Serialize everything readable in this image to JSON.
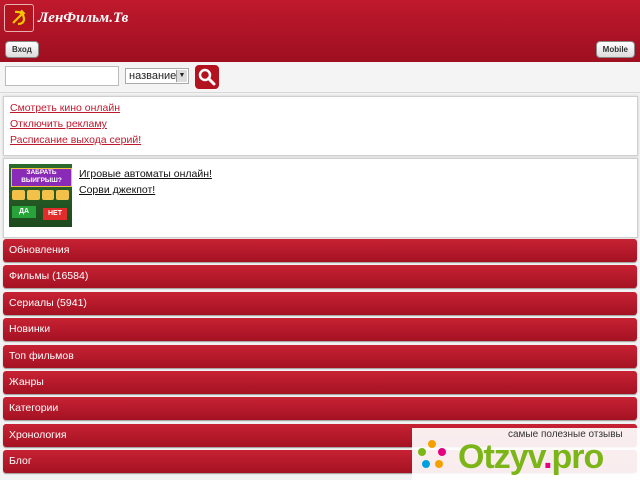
{
  "header": {
    "site_title": "ЛенФильм.Тв",
    "logo_icon": "hammer-sickle-icon",
    "login_label": "Вход",
    "mobile_label": "Mobile"
  },
  "search": {
    "input_value": "",
    "select_value": "название",
    "button_icon": "search-icon"
  },
  "links": [
    "Смотреть кино онлайн",
    "Отключить рекламу",
    "Расписание выхода серий!"
  ],
  "ad": {
    "banner_text": "ЗАБРАТЬ ВЫИГРЫШ?",
    "yes_label": "ДА",
    "no_label": "НЕТ",
    "line1": "Игровые автоматы онлайн!",
    "line2": "Сорви джекпот!"
  },
  "menu": [
    "Обновления",
    "Фильмы (16584)",
    "Сериалы (5941)",
    "Новинки",
    "Топ фильмов",
    "Жанры",
    "Категории",
    "Хронология",
    "Блог"
  ],
  "watermark": {
    "caption": "самые полезные отзывы",
    "logo_main": "Otzyv",
    "logo_dot": ".",
    "logo_tld": "pro"
  },
  "colors": {
    "brand_red": "#c0192d",
    "menu_red": "#a41222"
  }
}
